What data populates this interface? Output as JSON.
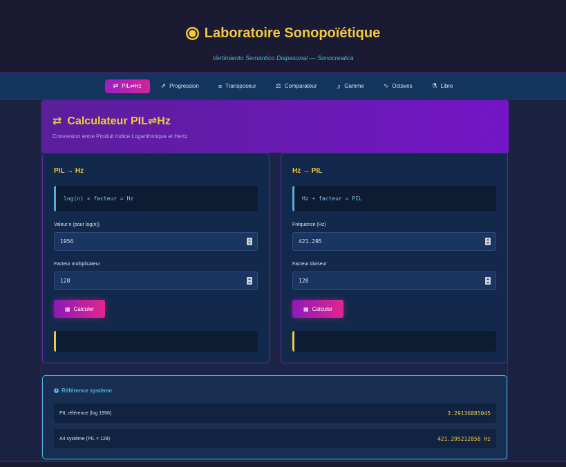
{
  "header": {
    "title": "Laboratoire Sonopoïétique",
    "subtitle": "Vertimiento Semántico Diapasonal — Sonocreatica"
  },
  "nav": {
    "tabs": [
      {
        "icon": "⇄",
        "label": "PIL⇌Hz",
        "active": true
      },
      {
        "icon": "⇗",
        "label": "Progression"
      },
      {
        "icon": "≡",
        "label": "Transposeur"
      },
      {
        "icon": "⚖",
        "label": "Comparateur"
      },
      {
        "icon": "♫",
        "label": "Gamme"
      },
      {
        "icon": "∿",
        "label": "Octaves"
      },
      {
        "icon": "⚗",
        "label": "Libre"
      }
    ]
  },
  "banner": {
    "title": "Calculateur PIL⇌Hz",
    "subtitle": "Conversion entre Produit Indice Logarithmique et Hertz"
  },
  "left": {
    "title": "PIL → Hz",
    "formula": "log(n) × facteur = Hz",
    "field1_label": "Valeur n (pour log(n))",
    "field1_value": "1956",
    "field2_label": "Facteur multiplicateur",
    "field2_value": "128",
    "button": "Calculer"
  },
  "right": {
    "title": "Hz → PIL",
    "formula": "Hz ÷ facteur = PIL",
    "field1_label": "Fréquence (Hz)",
    "field1_value": "421.295",
    "field2_label": "Facteur diviseur",
    "field2_value": "128",
    "button": "Calculer"
  },
  "reference": {
    "title": "Référence système",
    "rows": [
      {
        "label": "PIL référence (log 1956)",
        "value": "3.29136885045"
      },
      {
        "label": "A4 système (PIL × 128)",
        "value": "421.295212858 Hz"
      }
    ]
  },
  "colors": {
    "accent": "#f3c93a",
    "cyan": "#4fb3d9",
    "magenta": "#d0259a",
    "purple": "#7415c6"
  }
}
